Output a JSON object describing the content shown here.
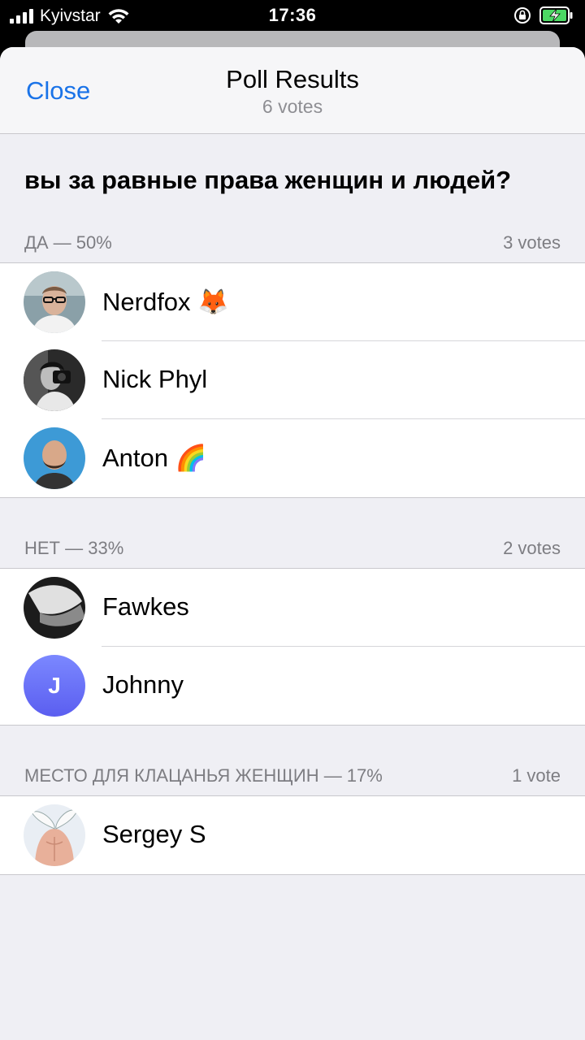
{
  "status_bar": {
    "carrier": "Kyivstar",
    "time": "17:36"
  },
  "nav": {
    "close_label": "Close",
    "title": "Poll Results",
    "subtitle": "6 votes"
  },
  "question": "вы за равные права женщин и людей?",
  "options": [
    {
      "label": "ДА — 50%",
      "votes": "3 votes",
      "voters": [
        {
          "name": "Nerdfox 🦊"
        },
        {
          "name": "Nick Phyl"
        },
        {
          "name": "Anton 🌈"
        }
      ]
    },
    {
      "label": "НЕТ — 33%",
      "votes": "2 votes",
      "voters": [
        {
          "name": "Fawkes"
        },
        {
          "name": "Johnny",
          "initial": "J"
        }
      ]
    },
    {
      "label": "МЕСТО ДЛЯ КЛАЦАНЬЯ ЖЕНЩИН — 17%",
      "votes": "1 vote",
      "voters": [
        {
          "name": "Sergey S"
        }
      ]
    }
  ]
}
